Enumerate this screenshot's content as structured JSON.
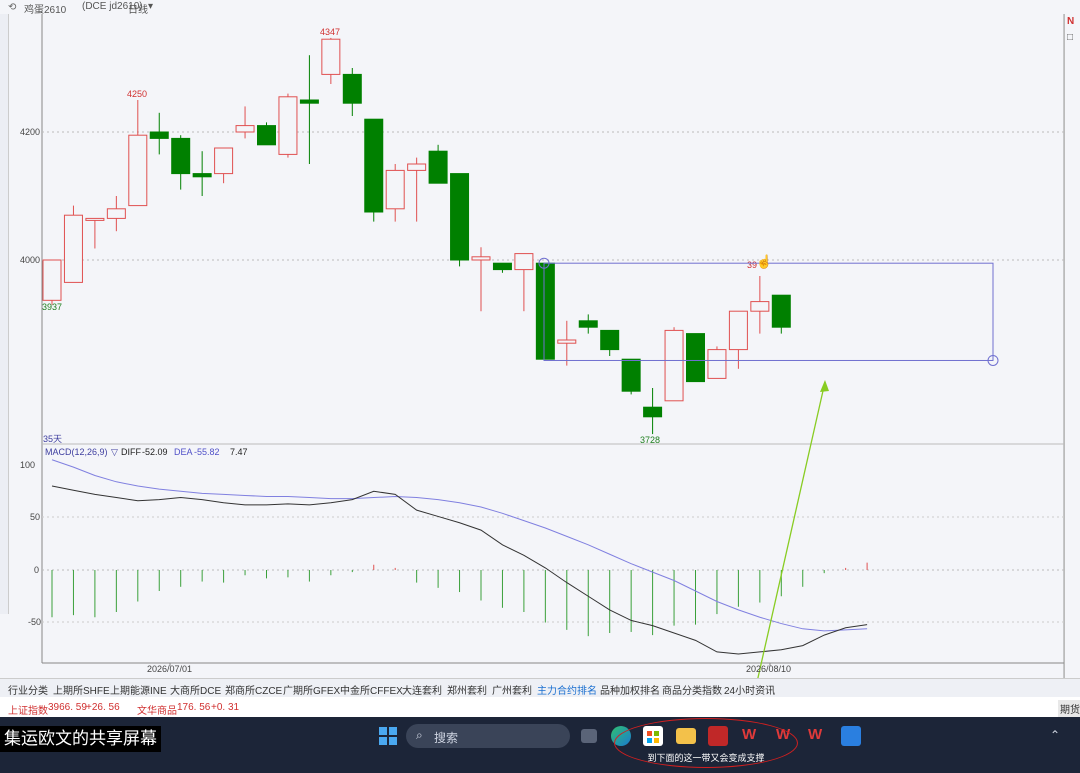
{
  "header": {
    "instrument": "鸡蛋2610",
    "exchange_code": "(DCE  jd2610)",
    "period": "日线",
    "period_caret": "▾"
  },
  "price_chart": {
    "labels": {
      "high_label_1": "4250",
      "high_label_2": "4347",
      "low_label_1": "3937",
      "low_label_2": "3728",
      "right_label": "39"
    },
    "y_ticks": [
      "4200",
      "4000"
    ],
    "periods_label": "35天"
  },
  "indicator": {
    "name": "MACD(12,26,9)",
    "caret": "▽",
    "diff_label": "DIFF",
    "diff_value": "-52.09",
    "dea_label": "DEA",
    "dea_value": "-55.82",
    "macd_value": "7.47",
    "y_ticks": [
      "100",
      "50",
      "0",
      "-50"
    ]
  },
  "x_axis": {
    "dates": [
      "2026/07/01",
      "2026/08/10"
    ]
  },
  "chart_data": {
    "type": "candlestick",
    "candles": [
      {
        "o": 3937,
        "h": 4000,
        "l": 3930,
        "c": 4000
      },
      {
        "o": 3965,
        "h": 4085,
        "l": 3965,
        "c": 4070
      },
      {
        "o": 4065,
        "h": 4065,
        "l": 4018,
        "c": 4065
      },
      {
        "o": 4065,
        "h": 4100,
        "l": 4045,
        "c": 4080
      },
      {
        "o": 4085,
        "h": 4250,
        "l": 4085,
        "c": 4195
      },
      {
        "o": 4200,
        "h": 4230,
        "l": 4165,
        "c": 4190
      },
      {
        "o": 4190,
        "h": 4195,
        "l": 4110,
        "c": 4135
      },
      {
        "o": 4135,
        "h": 4170,
        "l": 4100,
        "c": 4130
      },
      {
        "o": 4135,
        "h": 4175,
        "l": 4120,
        "c": 4175
      },
      {
        "o": 4200,
        "h": 4240,
        "l": 4190,
        "c": 4210
      },
      {
        "o": 4210,
        "h": 4215,
        "l": 4180,
        "c": 4180
      },
      {
        "o": 4165,
        "h": 4260,
        "l": 4160,
        "c": 4255
      },
      {
        "o": 4250,
        "h": 4320,
        "l": 4150,
        "c": 4245
      },
      {
        "o": 4290,
        "h": 4347,
        "l": 4275,
        "c": 4345
      },
      {
        "o": 4290,
        "h": 4300,
        "l": 4225,
        "c": 4245
      },
      {
        "o": 4220,
        "h": 4220,
        "l": 4060,
        "c": 4075
      },
      {
        "o": 4080,
        "h": 4150,
        "l": 4060,
        "c": 4140
      },
      {
        "o": 4140,
        "h": 4160,
        "l": 4060,
        "c": 4150
      },
      {
        "o": 4170,
        "h": 4180,
        "l": 4120,
        "c": 4120
      },
      {
        "o": 4135,
        "h": 4135,
        "l": 3990,
        "c": 4000
      },
      {
        "o": 4000,
        "h": 4020,
        "l": 3920,
        "c": 4005
      },
      {
        "o": 3995,
        "h": 3995,
        "l": 3980,
        "c": 3985
      },
      {
        "o": 3985,
        "h": 4010,
        "l": 3920,
        "c": 4010
      },
      {
        "o": 3995,
        "h": 3995,
        "l": 3845,
        "c": 3845
      },
      {
        "o": 3870,
        "h": 3905,
        "l": 3835,
        "c": 3875
      },
      {
        "o": 3905,
        "h": 3915,
        "l": 3885,
        "c": 3895
      },
      {
        "o": 3890,
        "h": 3890,
        "l": 3850,
        "c": 3860
      },
      {
        "o": 3845,
        "h": 3845,
        "l": 3790,
        "c": 3795
      },
      {
        "o": 3770,
        "h": 3800,
        "l": 3728,
        "c": 3755
      },
      {
        "o": 3780,
        "h": 3895,
        "l": 3780,
        "c": 3890
      },
      {
        "o": 3885,
        "h": 3885,
        "l": 3810,
        "c": 3810
      },
      {
        "o": 3815,
        "h": 3865,
        "l": 3815,
        "c": 3860
      },
      {
        "o": 3860,
        "h": 3915,
        "l": 3830,
        "c": 3920
      },
      {
        "o": 3920,
        "h": 3975,
        "l": 3885,
        "c": 3935
      },
      {
        "o": 3945,
        "h": 3945,
        "l": 3885,
        "c": 3895
      }
    ],
    "bands": {
      "upper": 3995,
      "lower": 3843
    },
    "macd": {
      "diff": [
        80,
        76,
        72,
        69,
        66,
        67,
        69,
        67,
        64,
        62,
        62,
        63,
        62,
        64,
        67,
        75,
        72,
        57,
        51,
        45,
        38,
        24,
        14,
        2,
        -12,
        -25,
        -38,
        -48,
        -53,
        -60,
        -67,
        -78,
        -80,
        -78,
        -76,
        -72,
        -62,
        -55,
        -52
      ],
      "dea": [
        105,
        98,
        90,
        84,
        80,
        77,
        75,
        73,
        72,
        71,
        70,
        70,
        69,
        68,
        68,
        69,
        70,
        69,
        67,
        64,
        60,
        54,
        47,
        40,
        32,
        24,
        15,
        6,
        -2,
        -10,
        -20,
        -30,
        -38,
        -45,
        -51,
        -56,
        -58,
        -57,
        -56
      ],
      "hist": [
        -45,
        -43,
        -45,
        -40,
        -30,
        -20,
        -16,
        -11,
        -12,
        -5,
        -8,
        -7,
        -11,
        -5,
        -2,
        5,
        2,
        -12,
        -17,
        -21,
        -29,
        -36,
        -40,
        -50,
        -57,
        -63,
        -60,
        -59,
        -62,
        -53,
        -52,
        -42,
        -35,
        -31,
        -25,
        -16,
        -3,
        2,
        7
      ]
    }
  },
  "tabs": [
    "行业分类",
    "上期所SHFE",
    "上期能源INE",
    "大商所DCE",
    "郑商所CZCE",
    "广期所GFEX",
    "中金所CFFEX",
    "大连套利",
    "郑州套利",
    "广州套利",
    "主力合约排名",
    "品种加权排名",
    "商品分类指数",
    "24小时资讯"
  ],
  "active_tab_index": 10,
  "index_bar": {
    "index1_name": "上证指数",
    "index1_value": "3966. 59",
    "index1_change": "+26. 56",
    "index2_name": "文华商品",
    "index2_value": "176. 56",
    "index2_change": "+0. 31",
    "right_button": "期货"
  },
  "taskbar": {
    "share_text": "集运欧文的共享屏幕",
    "search_placeholder": "搜索",
    "caption": "到下面的这一带又会变成支撑"
  },
  "colors": {
    "up": "#e05050",
    "down": "#008000",
    "diff_line": "#333333",
    "dea_line": "#8080e0",
    "box": "#7070d0",
    "arrow": "#88cc22"
  }
}
